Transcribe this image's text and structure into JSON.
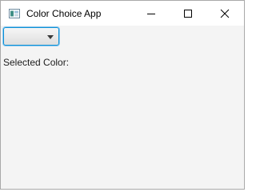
{
  "window": {
    "title": "Color Choice App",
    "icon": "java-app-icon",
    "controls": {
      "minimize_icon": "minimize-icon",
      "maximize_icon": "maximize-icon",
      "close_icon": "close-icon"
    }
  },
  "color_combo": {
    "selected_value": "",
    "arrow_icon": "chevron-down-icon",
    "focus_color": "#0a8fd6"
  },
  "selected_color_label": {
    "text": "Selected Color:"
  }
}
